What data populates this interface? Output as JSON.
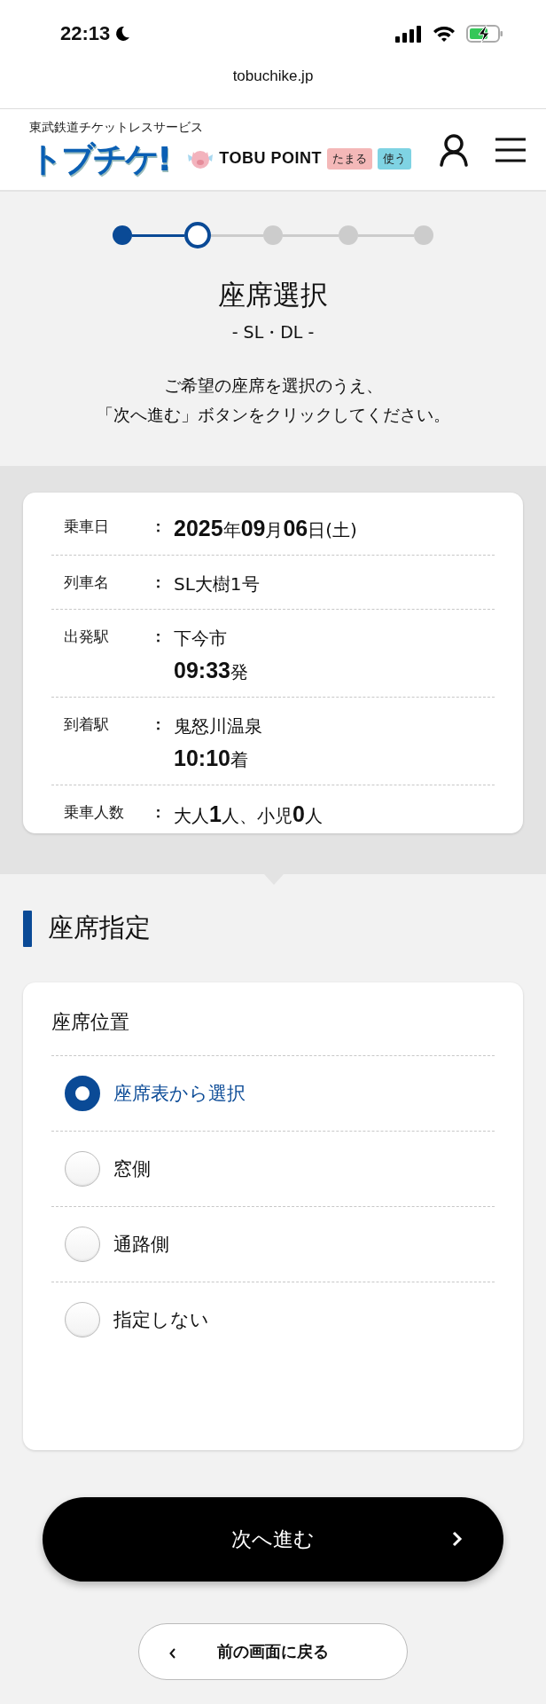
{
  "status_bar": {
    "time": "22:13"
  },
  "address_bar": {
    "url": "tobuchike.jp"
  },
  "header": {
    "tagline": "東武鉄道チケットレスサービス",
    "logo": "トブチケ!",
    "point_brand": "TOBU POINT",
    "point_tags": [
      {
        "label": "たまる",
        "color": "#f4b8b8"
      },
      {
        "label": "使う",
        "color": "#7fd3e3"
      }
    ]
  },
  "steps": [
    {
      "kind": "done"
    },
    {
      "kind": "current"
    },
    {
      "kind": "todo"
    },
    {
      "kind": "todo"
    },
    {
      "kind": "todo"
    }
  ],
  "page": {
    "title": "座席選択",
    "subtitle": "- SL・DL -",
    "message_lines": [
      "ご希望の座席を選択のうえ、",
      "「次へ進む」ボタンをクリックしてください。"
    ]
  },
  "trip": [
    {
      "label": "乗車日",
      "colon": "：",
      "lines": [
        "**2025**年**09**月**06**日(土)"
      ]
    },
    {
      "label": "列車名",
      "colon": "：",
      "lines": [
        "SL大樹1号"
      ]
    },
    {
      "label": "出発駅",
      "colon": "：",
      "lines": [
        "下今市",
        "**09:33**発"
      ]
    },
    {
      "label": "到着駅",
      "colon": "：",
      "lines": [
        "鬼怒川温泉",
        "**10:10**着"
      ]
    },
    {
      "label": "乗車人数",
      "colon": "：",
      "lines": [
        "大人**1**人、小児**0**人"
      ]
    }
  ],
  "seat_section": {
    "title": "座席指定",
    "group_label": "座席位置",
    "options": [
      {
        "label": "座席表から選択",
        "selected": true
      },
      {
        "label": "窓側",
        "selected": false
      },
      {
        "label": "通路側",
        "selected": false
      },
      {
        "label": "指定しない",
        "selected": false
      }
    ]
  },
  "buttons": {
    "next": {
      "label": "次へ進む"
    },
    "back": {
      "label": "前の画面に戻る"
    }
  }
}
